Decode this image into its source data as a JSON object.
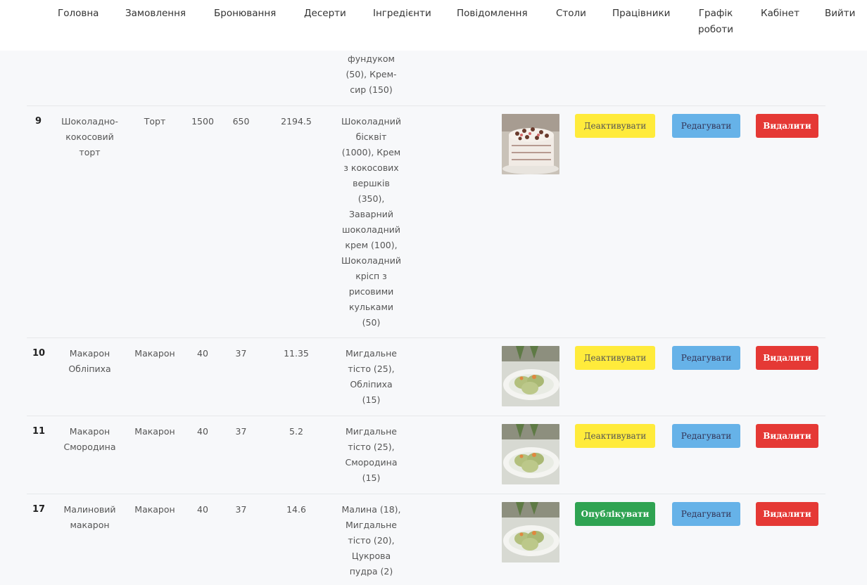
{
  "nav": {
    "items": [
      "Головна",
      "Замовлення",
      "Бронювання",
      "Десерти",
      "Інгредієнти",
      "Повідомлення",
      "Столи",
      "Працівники",
      "Графік\nроботи",
      "Кабінет",
      "Вийти"
    ]
  },
  "top_fragment": {
    "ingredients": "фундуком\n(50), Крем-\nсир (150)"
  },
  "rows": [
    {
      "id": "9",
      "name": "Шоколадно-\nкокосовий\nторт",
      "type": "Торт",
      "weight": "1500",
      "value2": "650",
      "price": "2194.5",
      "ingredients": "Шоколадний\nбісквіт\n(1000), Крем\nз кокосових\nвершків\n(350),\nЗаварний\nшоколадний\nкрем (100),\nШоколадний\nкрісп з\nрисовими\nкульками\n(50)",
      "image": "cake-photo",
      "status_label": "Деактивувати",
      "status_color": "#ffeb3b",
      "edit_label": "Редагувати",
      "delete_label": "Видалити"
    },
    {
      "id": "10",
      "name": "Макарон\nОбліпиха",
      "type": "Макарон",
      "weight": "40",
      "value2": "37",
      "price": "11.35",
      "ingredients": "Мигдальне\nтісто (25),\nОбліпиха\n(15)",
      "image": "macaron-photo",
      "status_label": "Деактивувати",
      "status_color": "#ffeb3b",
      "edit_label": "Редагувати",
      "delete_label": "Видалити"
    },
    {
      "id": "11",
      "name": "Макарон\nСмородина",
      "type": "Макарон",
      "weight": "40",
      "value2": "37",
      "price": "5.2",
      "ingredients": "Мигдальне\nтісто (25),\nСмородина\n(15)",
      "image": "macaron-photo",
      "status_label": "Деактивувати",
      "status_color": "#ffeb3b",
      "edit_label": "Редагувати",
      "delete_label": "Видалити"
    },
    {
      "id": "17",
      "name": "Малиновий\nмакарон",
      "type": "Макарон",
      "weight": "40",
      "value2": "37",
      "price": "14.6",
      "ingredients": "Малина (18),\nМигдальне\nтісто (20),\nЦукрова\nпудра (2)",
      "image": "macaron-photo",
      "status_label": "Опублікувати",
      "status_color": "#2fa352",
      "edit_label": "Редагувати",
      "delete_label": "Видалити"
    }
  ]
}
